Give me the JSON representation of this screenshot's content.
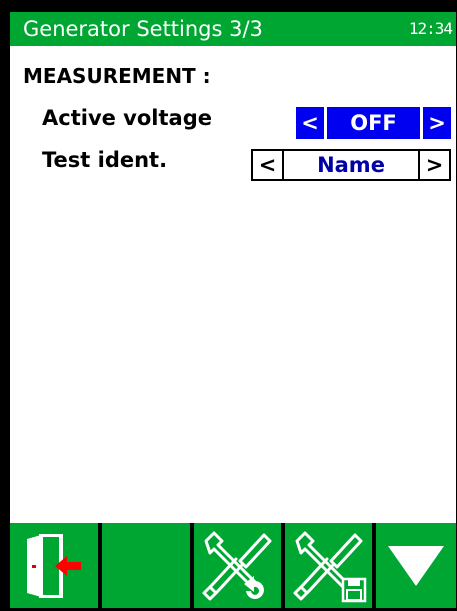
{
  "header": {
    "title": "Generator Settings 3/3",
    "clock": "12:34"
  },
  "section": {
    "title": "MEASUREMENT :"
  },
  "settings": [
    {
      "label": "Active voltage",
      "value": "OFF",
      "left_arrow": "<",
      "right_arrow": ">",
      "selected": true
    },
    {
      "label": "Test ident.",
      "value": "Name",
      "left_arrow": "<",
      "right_arrow": ">",
      "selected": false
    }
  ],
  "toolbar": {
    "buttons": [
      {
        "icon": "exit-door-icon"
      },
      {
        "icon": ""
      },
      {
        "icon": "tools-undo-icon"
      },
      {
        "icon": "tools-save-icon"
      },
      {
        "icon": "arrow-down-icon"
      }
    ]
  },
  "colors": {
    "accent_green": "#00a632",
    "selection_blue": "#0000f0",
    "value_blue": "#0000a8",
    "exit_arrow_red": "#ff0000"
  }
}
